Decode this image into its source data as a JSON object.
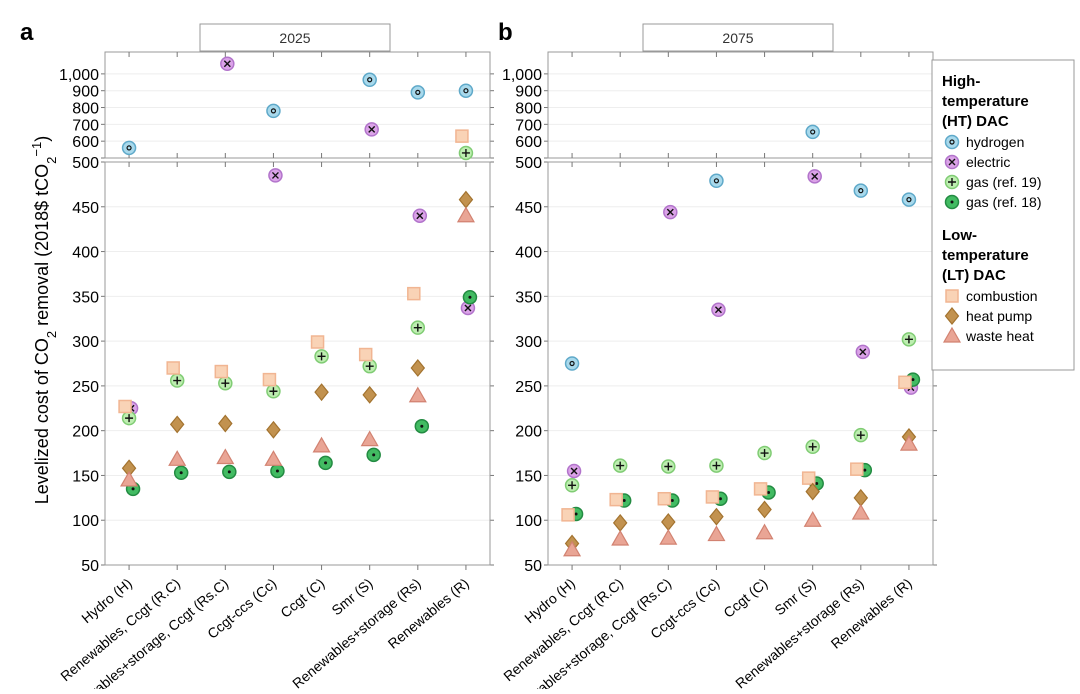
{
  "chart_data": [
    {
      "panel_label": "a",
      "strip_title": "2025",
      "type": "scatter",
      "categories": [
        "Hydro (H)",
        "Renewables, Ccgt (R.C)",
        "Renewables+storage, Ccgt (Rs.C)",
        "Ccgt-ccs (Cc)",
        "Ccgt (C)",
        "Smr (S)",
        "Renewables+storage (Rs)",
        "Renewables (R)"
      ],
      "series": [
        {
          "name": "hydrogen",
          "values": [
            560,
            null,
            null,
            780,
            null,
            965,
            890,
            900
          ]
        },
        {
          "name": "electric",
          "values": [
            225,
            null,
            1060,
            485,
            null,
            670,
            440,
            337
          ]
        },
        {
          "name": "gas (ref. 19)",
          "values": [
            214,
            256,
            253,
            244,
            283,
            272,
            315,
            530
          ]
        },
        {
          "name": "gas (ref. 18)",
          "values": [
            135,
            153,
            154,
            155,
            164,
            173,
            205,
            349
          ]
        },
        {
          "name": "combustion",
          "values": [
            227,
            270,
            266,
            257,
            299,
            285,
            353,
            630
          ]
        },
        {
          "name": "heat pump",
          "values": [
            158,
            207,
            208,
            201,
            243,
            240,
            270,
            458
          ]
        },
        {
          "name": "waste heat",
          "values": [
            145,
            168,
            170,
            168,
            183,
            190,
            239,
            440
          ]
        }
      ]
    },
    {
      "panel_label": "b",
      "strip_title": "2075",
      "type": "scatter",
      "categories": [
        "Hydro (H)",
        "Renewables, Ccgt (R.C)",
        "Renewables+storage, Ccgt (Rs.C)",
        "Ccgt-ccs (Cc)",
        "Ccgt (C)",
        "Smr (S)",
        "Renewables+storage (Rs)",
        "Renewables (R)"
      ],
      "series": [
        {
          "name": "hydrogen",
          "values": [
            275,
            null,
            null,
            479,
            null,
            655,
            468,
            458
          ]
        },
        {
          "name": "electric",
          "values": [
            155,
            null,
            444,
            335,
            null,
            484,
            288,
            248
          ]
        },
        {
          "name": "gas (ref. 19)",
          "values": [
            139,
            161,
            160,
            161,
            175,
            182,
            195,
            302
          ]
        },
        {
          "name": "gas (ref. 18)",
          "values": [
            107,
            122,
            122,
            124,
            131,
            141,
            156,
            257
          ]
        },
        {
          "name": "combustion",
          "values": [
            106,
            123,
            124,
            126,
            135,
            147,
            157,
            254
          ]
        },
        {
          "name": "heat pump",
          "values": [
            74,
            97,
            98,
            104,
            112,
            132,
            125,
            193
          ]
        },
        {
          "name": "waste heat",
          "values": [
            67,
            79,
            80,
            84,
            86,
            100,
            108,
            185
          ]
        }
      ]
    }
  ],
  "axes": {
    "ylabel": "Levelized cost of CO2 removal (2018$ tCO2−1)",
    "ylabel_parts": [
      "Levelized cost of CO",
      "2",
      " removal  (2018$  tCO",
      "2",
      "−1",
      ")"
    ],
    "upper_ylim": [
      500,
      1130
    ],
    "upper_ticks": [
      "500",
      "600",
      "700",
      "800",
      "900",
      "1,000"
    ],
    "upper_tick_values": [
      500,
      600,
      700,
      800,
      900,
      1000
    ],
    "lower_ylim": [
      50,
      500
    ],
    "lower_ticks": [
      "50",
      "100",
      "150",
      "200",
      "250",
      "300",
      "350",
      "400",
      "450",
      "500"
    ],
    "lower_tick_values": [
      50,
      100,
      150,
      200,
      250,
      300,
      350,
      400,
      450,
      500
    ],
    "grid": true,
    "scale_break": true
  },
  "legend": {
    "placement": "right",
    "groups": [
      {
        "title": "High-temperature (HT) DAC",
        "title_lines": [
          "High-",
          "temperature",
          "(HT) DAC"
        ],
        "items": [
          "hydrogen",
          "electric",
          "gas (ref. 19)",
          "gas (ref. 18)"
        ]
      },
      {
        "title": "Low-temperature (LT) DAC",
        "title_lines": [
          "Low-",
          "temperature",
          "(LT) DAC"
        ],
        "items": [
          "combustion",
          "heat pump",
          "waste heat"
        ]
      }
    ]
  },
  "styles": {
    "hydrogen": {
      "marker": "circle-dot",
      "fill": "#a8d9ec",
      "stroke": "#5fa9c9"
    },
    "electric": {
      "marker": "circle-x",
      "fill": "#dba3e8",
      "stroke": "#b274cb"
    },
    "gas (ref. 19)": {
      "marker": "circle-plus",
      "fill": "#bdeeb0",
      "stroke": "#80cc74"
    },
    "gas (ref. 18)": {
      "marker": "circle-dot-solid",
      "fill": "#42bb62",
      "stroke": "#238b42"
    },
    "combustion": {
      "marker": "square",
      "fill": "#f9d3b6",
      "stroke": "#f1b592"
    },
    "heat pump": {
      "marker": "diamond",
      "fill": "#c2924f",
      "stroke": "#a3732f"
    },
    "waste heat": {
      "marker": "triangle",
      "fill": "#e9a595",
      "stroke": "#d28271"
    }
  }
}
